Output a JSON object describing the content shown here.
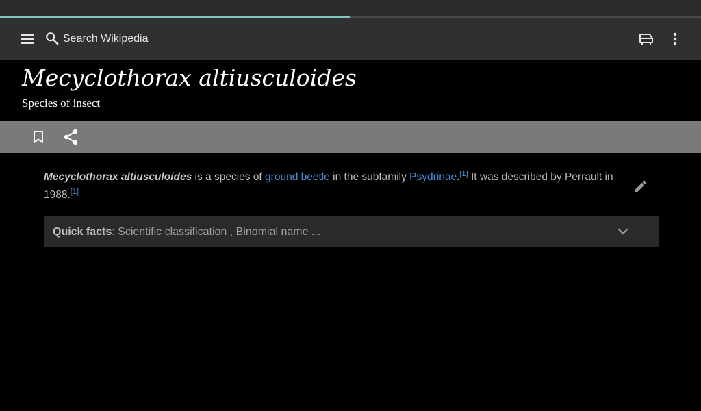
{
  "progress": {
    "fraction": 0.5,
    "color": "#7fc4be"
  },
  "toolbar": {
    "menu_icon": "menu-icon",
    "search_icon": "search-icon",
    "search_placeholder": "Search Wikipedia",
    "reading_lists_icon": "reading-list-icon",
    "more_icon": "more-vert-icon"
  },
  "article": {
    "title": "Mecyclothorax altiusculoides",
    "description": "Species of insect"
  },
  "actions": {
    "bookmark_icon": "bookmark-icon",
    "share_icon": "share-icon"
  },
  "body": {
    "term": "Mecyclothorax altiusculoides",
    "text_1": " is a species of ",
    "link_1": "ground beetle",
    "text_2": " in the subfamily ",
    "link_2": "Psydrinae",
    "text_3": ".",
    "ref_1": "[1]",
    "text_4": " It was described by Perrault in 1988.",
    "ref_2": "[1]",
    "edit_icon": "edit-pencil-icon"
  },
  "quick_facts": {
    "label": "Quick facts",
    "summary": ": Scientific classification , Binomial name ...",
    "chevron_icon": "chevron-down-icon"
  },
  "colors": {
    "link": "#4a90d9",
    "toolbar_bg": "#303032",
    "actionbar_bg": "#7a7a7a"
  }
}
